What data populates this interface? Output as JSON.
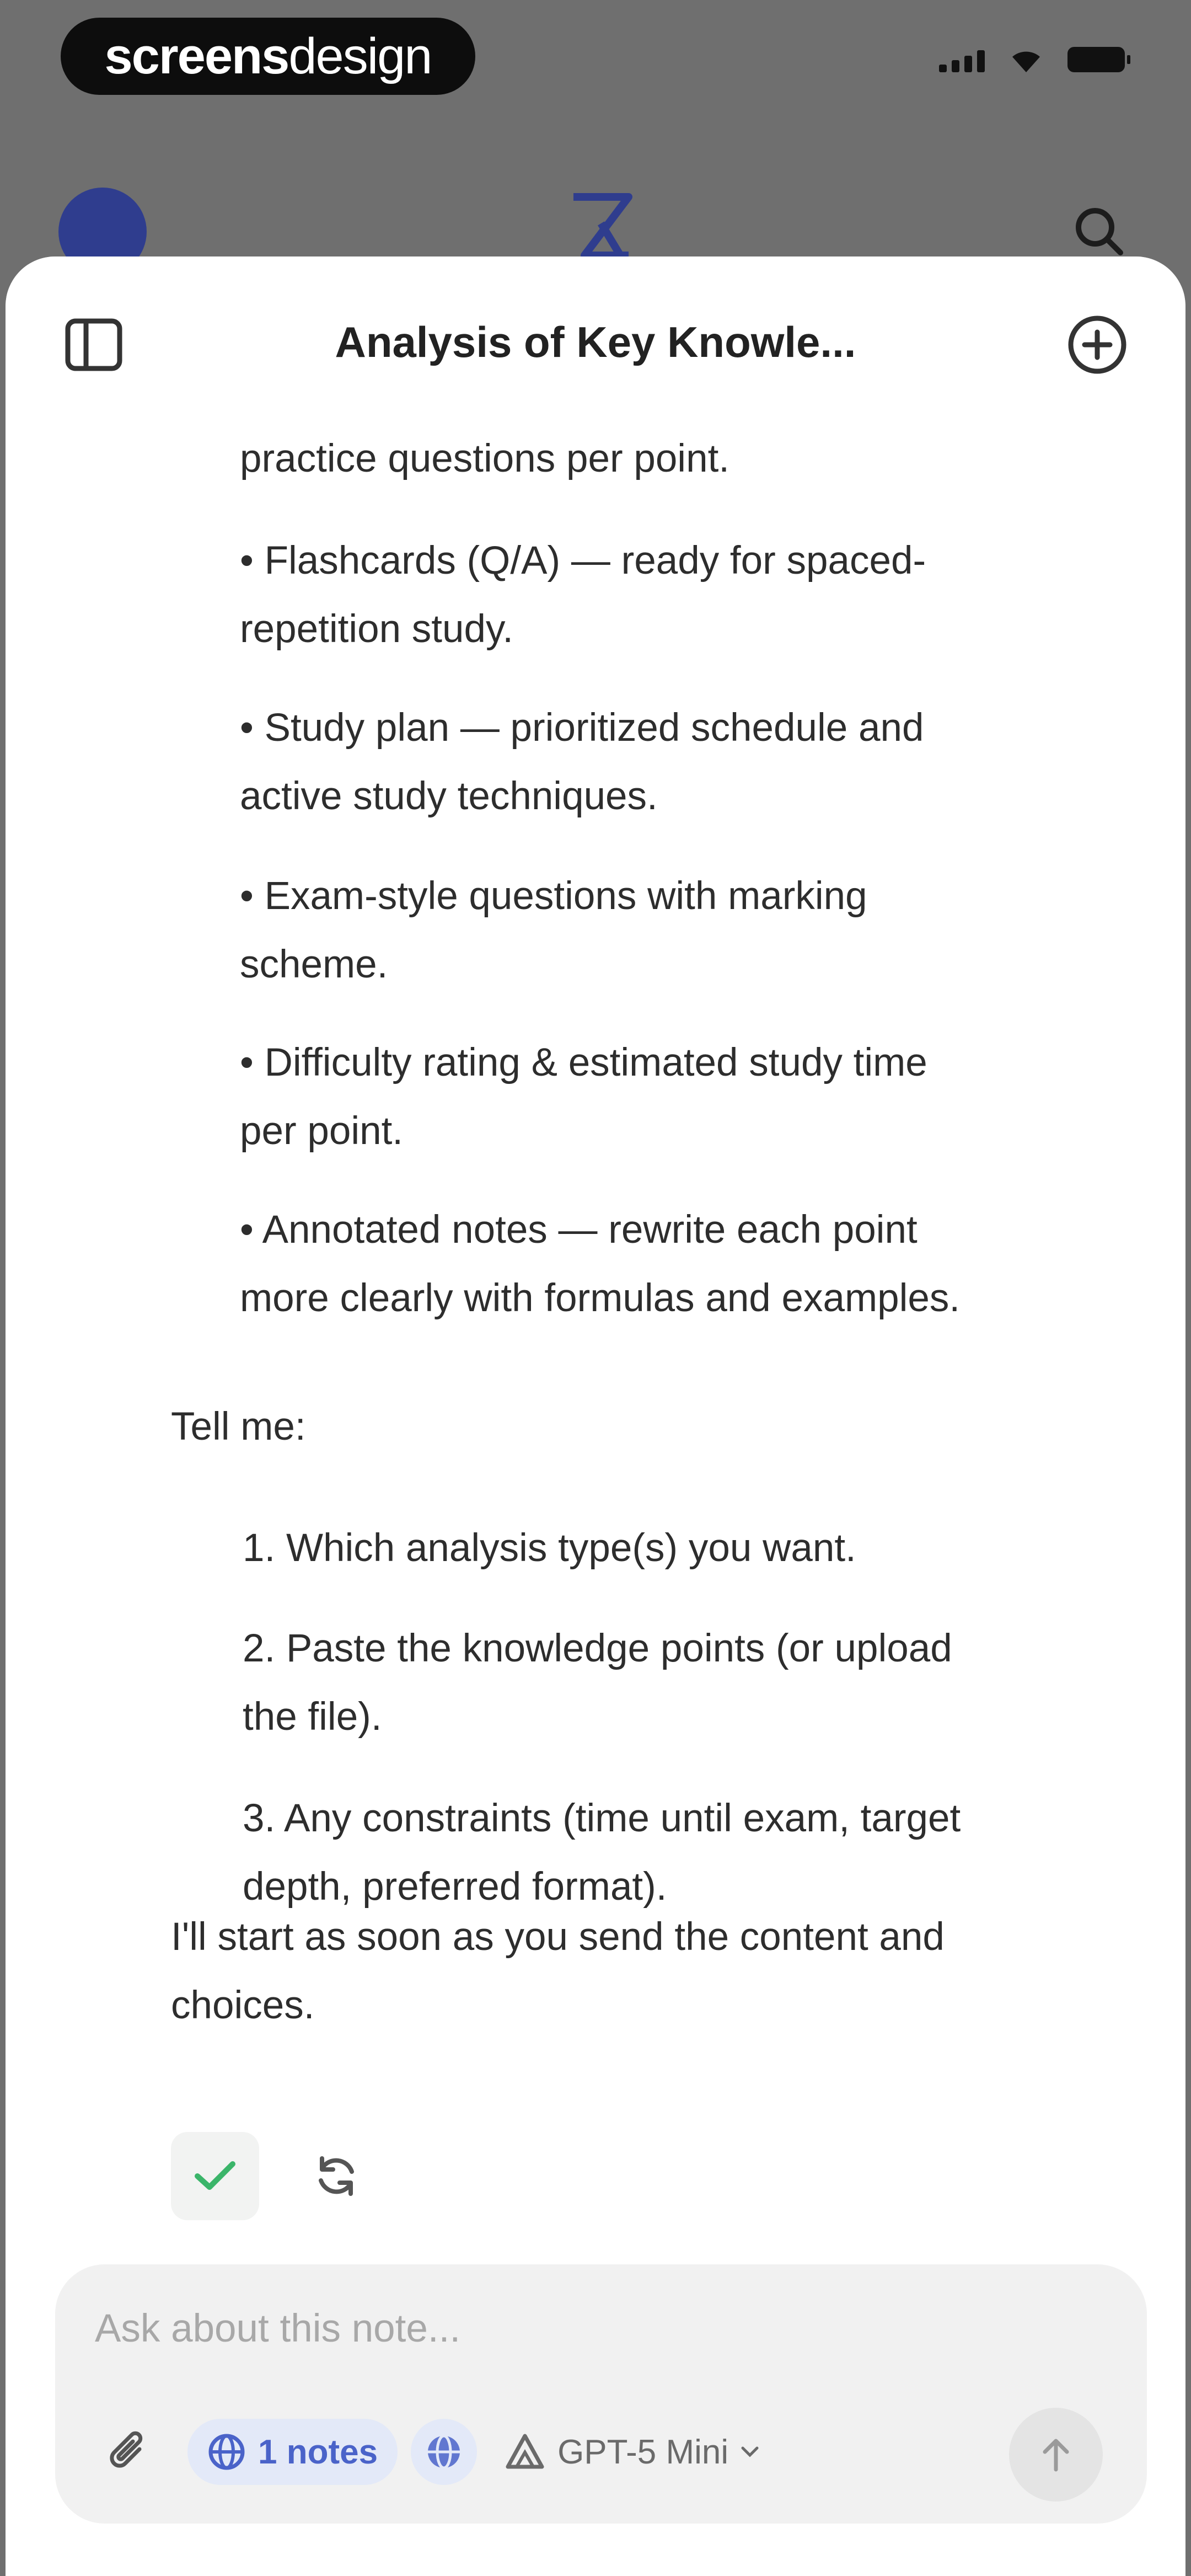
{
  "status_bar": {
    "brand_part1": "screens",
    "brand_part2": "design"
  },
  "sheet": {
    "title": "Analysis of Key Knowle..."
  },
  "message": {
    "bullets": [
      {
        "line1": "practice questions per point.",
        "line2": ""
      },
      {
        "line1": "• Flashcards (Q/A) — ready for spaced-",
        "line2": "repetition study."
      },
      {
        "line1": "• Study plan — prioritized schedule and",
        "line2": "active study techniques."
      },
      {
        "line1": "• Exam-style questions with marking",
        "line2": "scheme."
      },
      {
        "line1": "• Difficulty rating & estimated study time",
        "line2": "per point."
      },
      {
        "line1": "• Annotated notes — rewrite each point",
        "line2": "more clearly with formulas and examples."
      }
    ],
    "tell_me": "Tell me:",
    "steps": [
      {
        "line1": "1. Which analysis type(s) you want.",
        "line2": ""
      },
      {
        "line1": "2. Paste the knowledge points (or upload",
        "line2": "the file)."
      },
      {
        "line1": "3. Any constraints (time until exam, target",
        "line2": "depth, preferred format)."
      }
    ],
    "closing_line1": "I'll start as soon as you send the content and",
    "closing_line2": "choices."
  },
  "composer": {
    "placeholder": "Ask about this note...",
    "notes_chip": "1 notes",
    "model": "GPT-5 Mini"
  },
  "colors": {
    "accent_blue": "#4a63c9",
    "check_green": "#3bb56a",
    "overlay_gray": "#6f6f6f"
  },
  "icons": {
    "sidebar": "sidebar-icon",
    "new_chat": "plus-circle-icon",
    "check": "check-icon",
    "regenerate": "refresh-icon",
    "attach": "paperclip-icon",
    "globe": "globe-icon",
    "model": "model-icon",
    "send": "arrow-up-icon"
  }
}
